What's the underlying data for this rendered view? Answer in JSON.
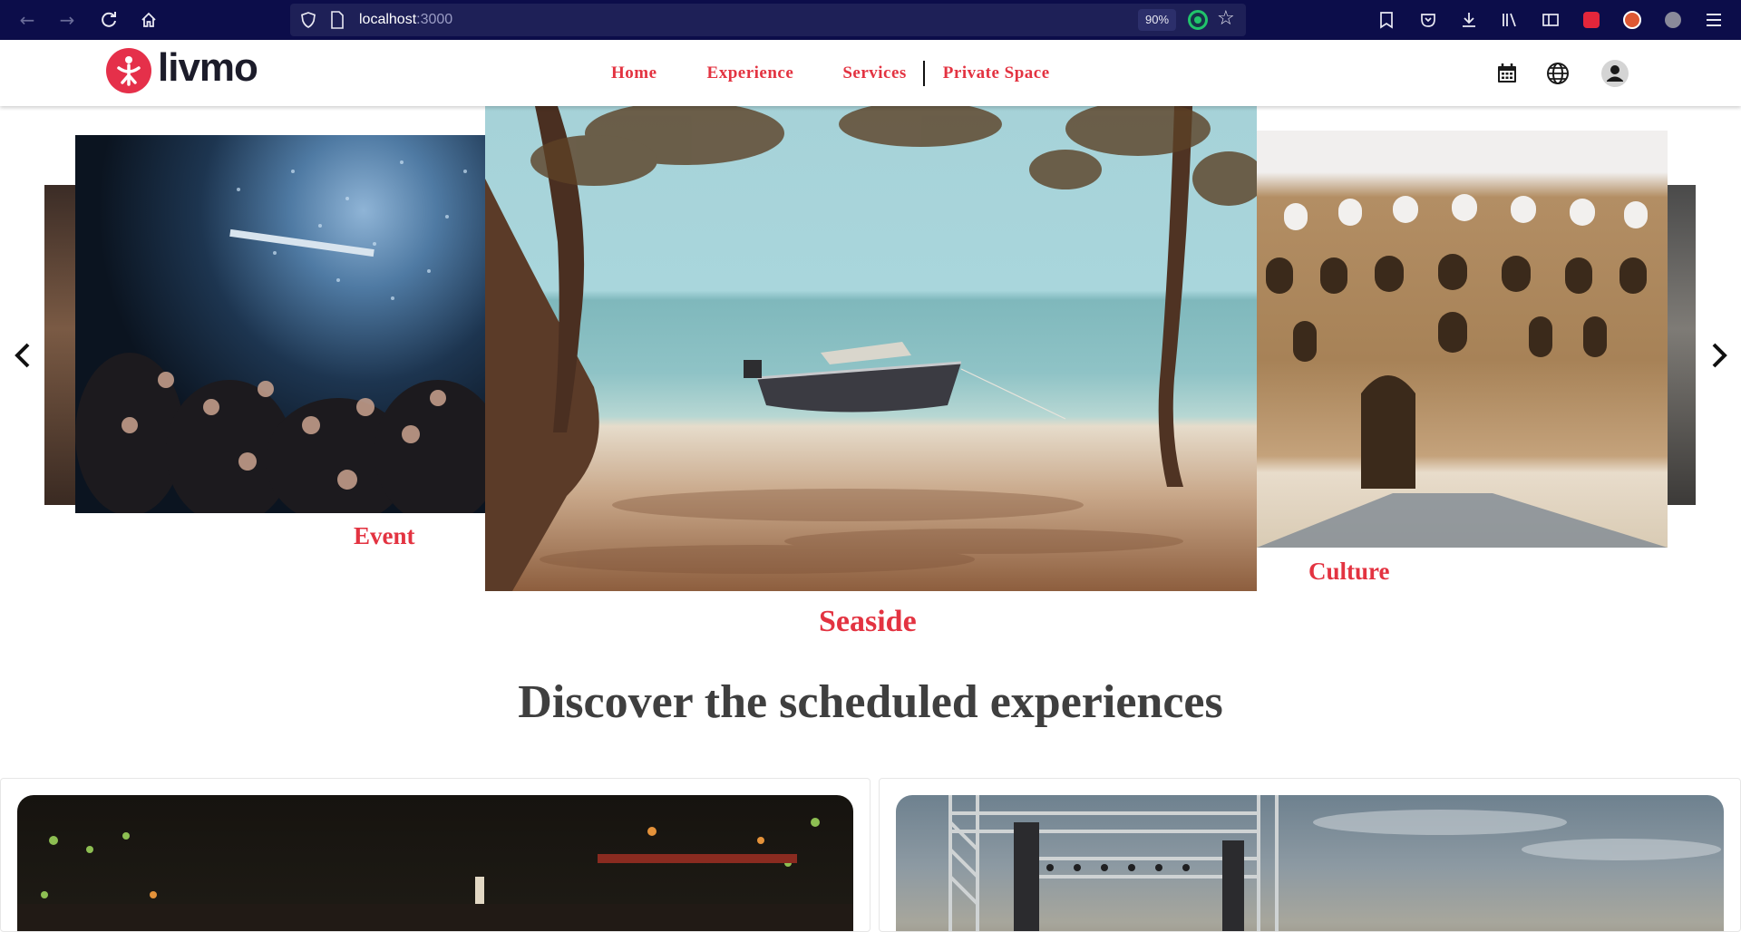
{
  "browser": {
    "url_host": "localhost",
    "url_port": ":3000",
    "zoom": "90%"
  },
  "site": {
    "brand": "livmo",
    "nav": {
      "home": "Home",
      "experience": "Experience",
      "services": "Services",
      "private_space": "Private Space"
    }
  },
  "carousel": {
    "slides": [
      {
        "caption": "Event"
      },
      {
        "caption": "Seaside"
      },
      {
        "caption": "Culture"
      }
    ]
  },
  "section": {
    "title": "Discover the scheduled experiences"
  },
  "colors": {
    "accent": "#e33341",
    "chrome": "#0c0d4a",
    "heading": "#3f3f3f"
  }
}
